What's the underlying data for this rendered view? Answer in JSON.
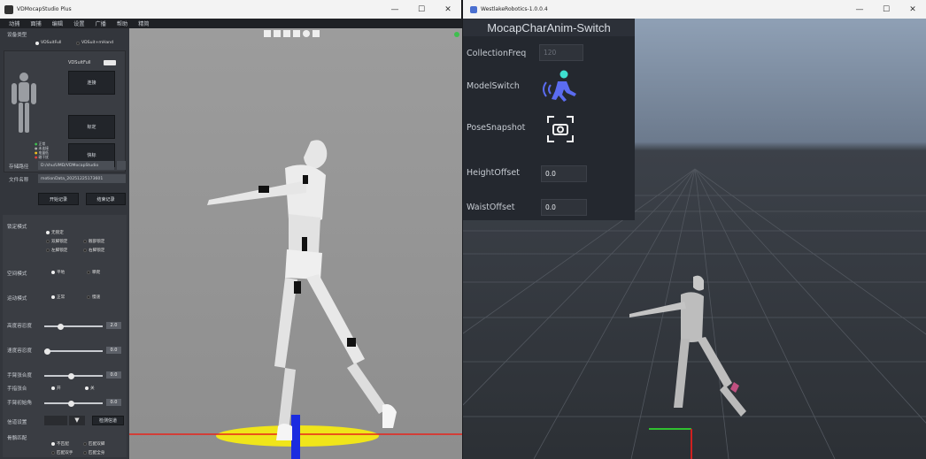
{
  "left_window": {
    "title": "VDMocapStudio Plus",
    "menu": [
      "动捕",
      "面捕",
      "编辑",
      "设置",
      "广播",
      "帮助",
      "精简"
    ],
    "device_type_label": "设备类型",
    "device_options": [
      "VDSuitFull",
      "VDSuit+mHand"
    ],
    "device_name": "VDSuitFull",
    "connect_button": "连接",
    "calibrate_button": "标定",
    "quick_button": "快标",
    "legend": [
      "正常",
      "未连接",
      "电量低",
      "磁干扰"
    ],
    "save_path_label": "存储路径",
    "save_path_value": "D:/shu/UMD/VDMocapStudio",
    "filename_label": "文件名称",
    "filename_value": "motionData_20251225173601",
    "start_record": "开始记录",
    "stop_record": "结束记录",
    "lock_mode_label": "锁定模式",
    "lock_options": [
      "无锁定",
      "双脚锁定",
      "髋部锁定",
      "左脚锁定",
      "右脚锁定"
    ],
    "space_mode_label": "空间模式",
    "space_options": [
      "平地",
      "攀爬"
    ],
    "motion_mode_label": "运动模式",
    "motion_options": [
      "正常",
      "慢速"
    ],
    "height_tol_label": "高度容忍度",
    "height_tol_value": "2.0",
    "height_tol_fraction": 0.25,
    "speed_tol_label": "速度容忍度",
    "speed_tol_value": "0.0",
    "speed_tol_fraction": 0.0,
    "arm_open_label": "手臂张合度",
    "arm_open_value": "0.0",
    "arm_open_fraction": 0.45,
    "finger_close_label": "手指张合",
    "finger_close_options": [
      "开",
      "关"
    ],
    "finger_init_label": "手臂初始角",
    "finger_init_value": "0.0",
    "finger_init_fraction": 0.45,
    "channel_label": "信道设置",
    "channel_button": "检测信道",
    "bone_match_label": "骨骼匹配",
    "bone_options": [
      "不匹配",
      "匹配双脚",
      "匹配双手",
      "匹配全身"
    ]
  },
  "right_window": {
    "title": "WestlakeRobotics-1.0.0.4",
    "panel_title": "MocapCharAnim-Switch",
    "collection_freq_label": "CollectionFreq",
    "collection_freq_value": "120",
    "model_switch_label": "ModelSwitch",
    "pose_snapshot_label": "PoseSnapshot",
    "height_offset_label": "HeightOffset",
    "height_offset_value": "0.0",
    "waist_offset_label": "WaistOffset",
    "waist_offset_value": "0.0"
  },
  "colors": {
    "accent_green": "#3fbf4f",
    "icon_blue": "#5b6cf0",
    "icon_cyan": "#3ee0d0",
    "ground_yellow": "#f0e51a"
  }
}
